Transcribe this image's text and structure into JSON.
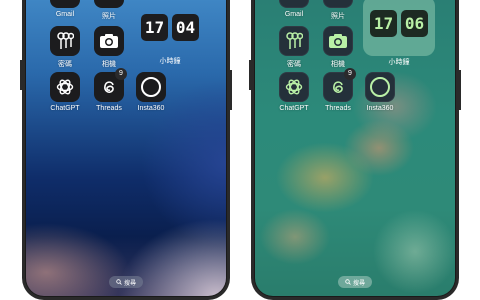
{
  "left_phone": {
    "apps": [
      {
        "label": "Gmail",
        "icon": "gmail-icon"
      },
      {
        "label": "照片",
        "icon": "photos-icon"
      },
      {
        "label": "密碼",
        "icon": "passwords-icon"
      },
      {
        "label": "相機",
        "icon": "camera-icon"
      },
      {
        "label": "ChatGPT",
        "icon": "chatgpt-icon"
      },
      {
        "label": "Threads",
        "icon": "threads-icon",
        "badge": "9"
      },
      {
        "label": "Insta360",
        "icon": "insta360-icon"
      }
    ],
    "clock_widget": {
      "hour": "17",
      "minute": "04",
      "label": "小時鐘"
    },
    "search_label": "搜尋"
  },
  "right_phone": {
    "apps": [
      {
        "label": "Gmail",
        "icon": "gmail-icon"
      },
      {
        "label": "照片",
        "icon": "photos-icon"
      },
      {
        "label": "密碼",
        "icon": "passwords-icon"
      },
      {
        "label": "相機",
        "icon": "camera-icon"
      },
      {
        "label": "ChatGPT",
        "icon": "chatgpt-icon"
      },
      {
        "label": "Threads",
        "icon": "threads-icon",
        "badge": "9"
      },
      {
        "label": "Insta360",
        "icon": "insta360-icon"
      }
    ],
    "clock_widget": {
      "hour": "17",
      "minute": "06",
      "label": "小時鐘"
    },
    "search_label": "搜尋"
  },
  "colors": {
    "left_wallpaper_top": "#3f86c4",
    "left_wallpaper_bottom": "#0a1f4e",
    "right_wallpaper": "#2c8a7a",
    "right_icon_tint": "#b9f0a6"
  }
}
